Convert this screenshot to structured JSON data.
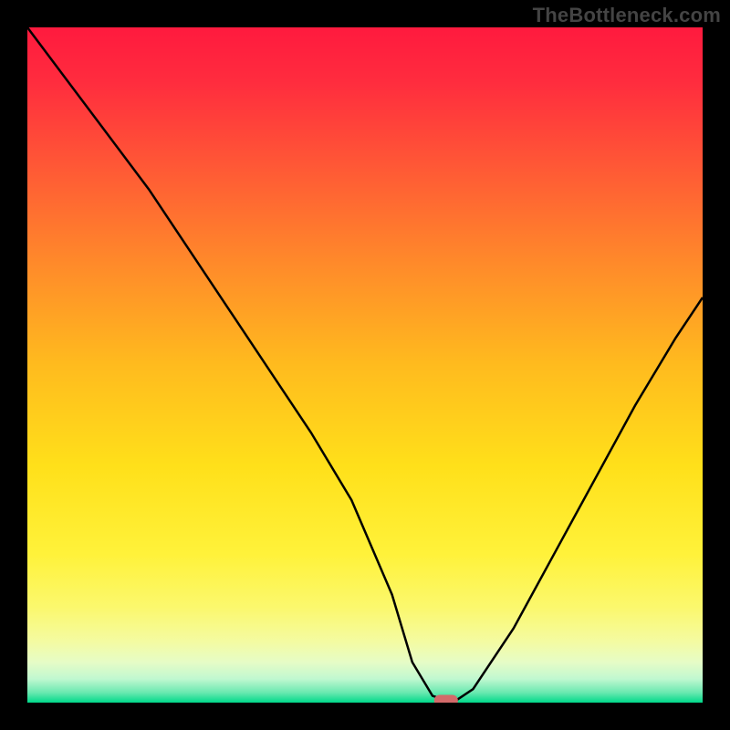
{
  "attribution": "TheBottleneck.com",
  "chart_data": {
    "type": "line",
    "title": "",
    "xlabel": "",
    "ylabel": "",
    "xlim": [
      0,
      100
    ],
    "ylim": [
      0,
      100
    ],
    "x": [
      0,
      6,
      12,
      18,
      24,
      30,
      36,
      42,
      48,
      54,
      57,
      60,
      63,
      66,
      72,
      78,
      84,
      90,
      96,
      100
    ],
    "values": [
      100,
      92,
      84,
      76,
      67,
      58,
      49,
      40,
      30,
      16,
      6,
      1,
      0,
      2,
      11,
      22,
      33,
      44,
      54,
      60
    ],
    "marker": {
      "x": 62,
      "y": 0
    },
    "background_gradient": {
      "stops": [
        {
          "offset": 0.0,
          "color": "#ff1a3e"
        },
        {
          "offset": 0.08,
          "color": "#ff2c3e"
        },
        {
          "offset": 0.2,
          "color": "#ff5636"
        },
        {
          "offset": 0.35,
          "color": "#ff8a2a"
        },
        {
          "offset": 0.5,
          "color": "#ffbb1e"
        },
        {
          "offset": 0.65,
          "color": "#ffe01a"
        },
        {
          "offset": 0.78,
          "color": "#fff23a"
        },
        {
          "offset": 0.86,
          "color": "#fbf86e"
        },
        {
          "offset": 0.91,
          "color": "#f4fba2"
        },
        {
          "offset": 0.94,
          "color": "#e6fcc6"
        },
        {
          "offset": 0.965,
          "color": "#c0f8d0"
        },
        {
          "offset": 0.985,
          "color": "#6ae9b0"
        },
        {
          "offset": 1.0,
          "color": "#00d98a"
        }
      ]
    },
    "marker_color": "#d36a6a",
    "line_color": "#000000"
  }
}
